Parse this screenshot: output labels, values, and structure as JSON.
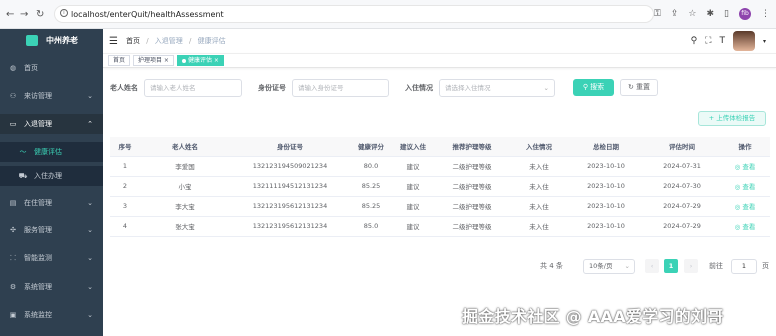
{
  "browser": {
    "url": "localhost/enterQuit/healthAssessment",
    "profile_initials": "fib"
  },
  "sidebar": {
    "logo_text": "中州养老",
    "items": [
      {
        "label": "首页",
        "icon": "dashboard-icon"
      },
      {
        "label": "来访管理",
        "icon": "visit-icon"
      },
      {
        "label": "入退管理",
        "icon": "inout-icon"
      },
      {
        "label": "健康评估",
        "icon": "health-icon"
      },
      {
        "label": "入住办理",
        "icon": "checkin-icon"
      },
      {
        "label": "在住管理",
        "icon": "resident-icon"
      },
      {
        "label": "服务管理",
        "icon": "service-icon"
      },
      {
        "label": "智能监测",
        "icon": "monitor-icon"
      },
      {
        "label": "系统管理",
        "icon": "settings-icon"
      },
      {
        "label": "系统监控",
        "icon": "system-monitor-icon"
      }
    ]
  },
  "breadcrumb": {
    "home": "首页",
    "parent": "入退管理",
    "current": "健康评估"
  },
  "tabs": [
    {
      "label": "首页"
    },
    {
      "label": "护理项目 ×"
    },
    {
      "label": "健康评估 ×"
    }
  ],
  "filters": {
    "name_label": "老人姓名",
    "name_placeholder": "请输入老人姓名",
    "id_label": "身份证号",
    "id_placeholder": "请输入身份证号",
    "status_label": "入住情况",
    "status_placeholder": "请选择入住情况",
    "search": "搜索",
    "reset": "重置"
  },
  "upload_label": "上传体检报告",
  "table": {
    "headers": [
      "序号",
      "老人姓名",
      "身份证号",
      "健康评分",
      "建议入住",
      "推荐护理等级",
      "入住情况",
      "总检日期",
      "评估时间",
      "操作"
    ],
    "rows": [
      [
        "1",
        "李爱国",
        "132123194509021234",
        "80.0",
        "建议",
        "二级护理等级",
        "未入住",
        "2023-10-10",
        "2024-07-31",
        "查看"
      ],
      [
        "2",
        "小宝",
        "132111194512131234",
        "85.25",
        "建议",
        "二级护理等级",
        "未入住",
        "2023-10-10",
        "2024-07-30",
        "查看"
      ],
      [
        "3",
        "李大宝",
        "132123195612131234",
        "85.25",
        "建议",
        "二级护理等级",
        "未入住",
        "2023-10-10",
        "2024-07-29",
        "查看"
      ],
      [
        "4",
        "张大宝",
        "132123195612131234",
        "85.0",
        "建议",
        "二级护理等级",
        "未入住",
        "2023-10-10",
        "2024-07-29",
        "查看"
      ]
    ]
  },
  "pagination": {
    "total": "共 4 条",
    "size": "10条/页",
    "current": "1",
    "goto": "前往",
    "goto_value": "1",
    "unit": "页"
  },
  "watermark": "掘金技术社区 @ AAA爱学习的刘哥",
  "colors": {
    "accent": "#3bd2b6",
    "sidebar": "#2f4050"
  }
}
